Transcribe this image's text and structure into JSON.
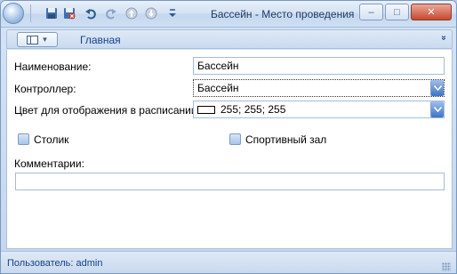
{
  "window": {
    "title": "Бассейн - Место проведения"
  },
  "quick_access": {
    "icons": [
      "save-icon",
      "save-close-icon",
      "undo-icon",
      "redo-icon",
      "move-up-icon",
      "move-down-icon",
      "customize-toolbar-icon"
    ]
  },
  "window_controls": {
    "minimize": "–",
    "maximize": "□",
    "close": "✕"
  },
  "ribbon": {
    "tab_main": "Главная",
    "collapse": "»"
  },
  "form": {
    "name_label": "Наименование:",
    "name_value": "Бассейн",
    "controller_label": "Контроллер:",
    "controller_value": "Бассейн",
    "color_label": "Цвет для отображения в расписании:",
    "color_value": "255; 255; 255",
    "color_swatch": "#ffffff",
    "table_checkbox_label": "Столик",
    "table_checked": false,
    "gym_checkbox_label": "Спортивный зал",
    "gym_checked": false,
    "comments_label": "Комментарии:",
    "comments_value": ""
  },
  "status": {
    "user_text": "Пользователь: admin"
  },
  "colors": {
    "accent": "#15428b",
    "frame": "#c3d6ee",
    "dropdown": "#3d74c4"
  }
}
